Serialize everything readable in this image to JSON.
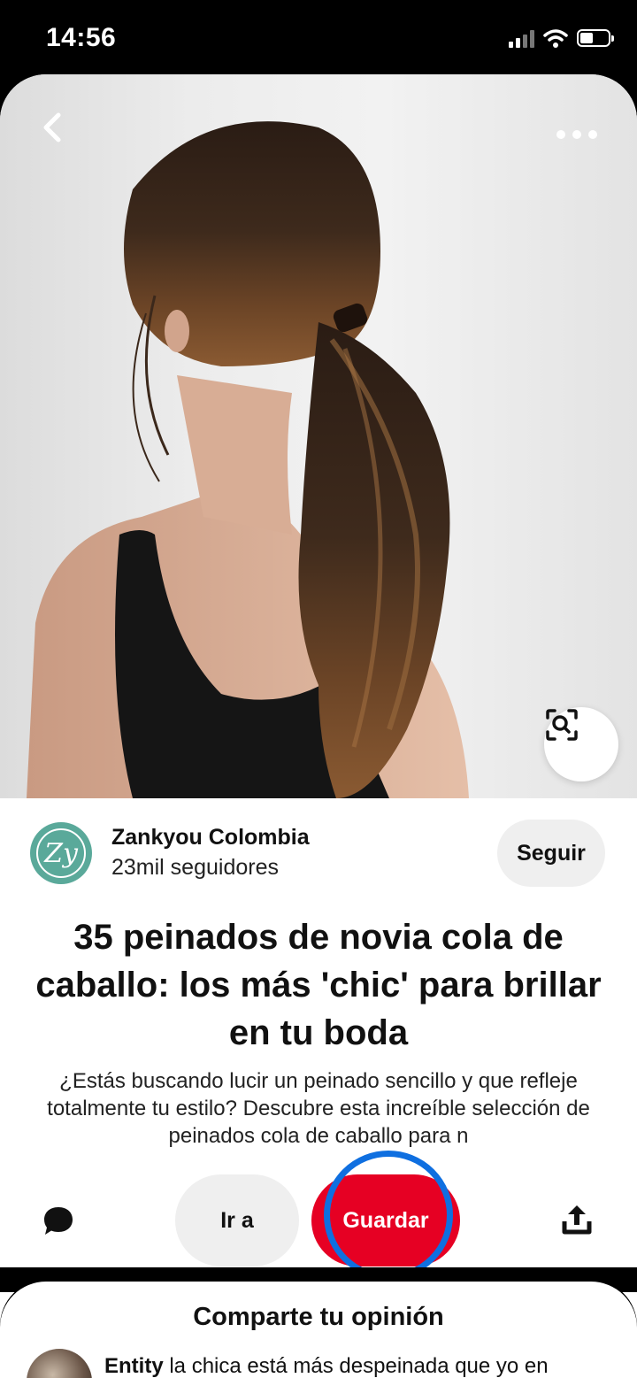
{
  "status_bar": {
    "time": "14:56"
  },
  "pin": {
    "image_alt": "",
    "title": "35 peinados de novia cola de caballo: los más 'chic' para brillar en tu boda",
    "description": "¿Estás buscando lucir un peinado sencillo y que refleje totalmente tu estilo? Descubre esta increíble selección de peinados cola de caballo para n"
  },
  "creator": {
    "name": "Zankyou Colombia",
    "followers": "23mil seguidores",
    "avatar_initials": "Zy",
    "follow_label": "Seguir"
  },
  "actions": {
    "visit_label": "Ir a",
    "save_label": "Guardar"
  },
  "comments": {
    "title": "Comparte tu opinión",
    "preview_author": "Entity",
    "preview_text": " la chica está más despeinada que yo en"
  },
  "colors": {
    "save_red": "#e60023",
    "highlight_blue": "#0f6fe0",
    "avatar_teal": "#5aa99a"
  },
  "icons": {
    "back": "chevron-left-icon",
    "more": "ellipsis-icon",
    "lens": "visual-search-icon",
    "comment": "comment-bubble-icon",
    "share": "share-upload-icon"
  }
}
